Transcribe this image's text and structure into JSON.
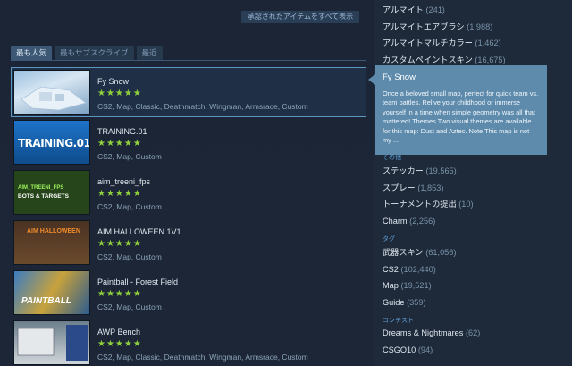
{
  "top": {
    "show_all_label": "承認されたアイテムをすべて表示"
  },
  "tabs": [
    {
      "label": "最も人気"
    },
    {
      "label": "最もサブスクライブ"
    },
    {
      "label": "最近"
    }
  ],
  "items": [
    {
      "title": "Fy Snow",
      "stars": "★★★★★",
      "tags": "CS2, Map, Classic, Deathmatch, Wingman, Armsrace, Custom",
      "rating": 5
    },
    {
      "title": "TRAINING.01",
      "stars": "★★★★★",
      "tags": "CS2, Map, Custom",
      "thumb_text": "TRAINING.01",
      "rating": 5
    },
    {
      "title": "aim_treeni_fps",
      "stars": "★★★★★",
      "tags": "CS2, Map, Custom",
      "thumb_text": "AIM_TREENI_FPS",
      "thumb_text2": "BOTS & TARGETS",
      "rating": 5
    },
    {
      "title": "AIM HALLOWEEN 1V1",
      "stars": "★★★★★",
      "tags": "CS2, Map, Custom",
      "thumb_text": "AIM HALLOWEEN",
      "rating": 5
    },
    {
      "title": "Paintball - Forest Field",
      "stars": "★★★★★",
      "tags": "CS2, Map, Custom",
      "thumb_text": "PAINTBALL",
      "rating": 5
    },
    {
      "title": "AWP Bench",
      "stars": "★★★★★",
      "tags": "CS2, Map, Classic, Deathmatch, Wingman, Armsrace, Custom",
      "rating": 5
    }
  ],
  "tooltip": {
    "title": "Fy Snow",
    "description": "Once a beloved small map, perfect for quick team vs. team battles. Relive your childhood or immerse yourself in a time when simple geometry was all that mattered! Themes Two visual themes are available for this map: Dust and Aztec. Note This map is not my ..."
  },
  "sidebar": {
    "top_items": [
      {
        "label": "アルマイト",
        "count": "(241)"
      },
      {
        "label": "アルマイトエアブラシ",
        "count": "(1,988)"
      },
      {
        "label": "アルマイトマルチカラー",
        "count": "(1,462)"
      },
      {
        "label": "カスタムペイントスキン",
        "count": "(16,675)"
      }
    ],
    "other_section": "その他",
    "other_items": [
      {
        "label": "ステッカー",
        "count": "(19,565)"
      },
      {
        "label": "スプレー",
        "count": "(1,853)"
      },
      {
        "label": "トーナメントの提出",
        "count": "(10)"
      },
      {
        "label": "Charm",
        "count": "(2,256)"
      }
    ],
    "tag_section": "タグ",
    "tag_items": [
      {
        "label": "武器スキン",
        "count": "(61,056)"
      },
      {
        "label": "CS2",
        "count": "(102,440)"
      },
      {
        "label": "Map",
        "count": "(19,521)"
      },
      {
        "label": "Guide",
        "count": "(359)"
      }
    ],
    "contest_section": "コンテスト",
    "contest_items": [
      {
        "label": "Dreams & Nightmares",
        "count": "(62)"
      },
      {
        "label": "CSGO10",
        "count": "(94)"
      }
    ]
  },
  "colors": {
    "star": "#8fcf3c",
    "tooltip_bg": "#5e8bac",
    "accent": "#5ea0d8"
  }
}
